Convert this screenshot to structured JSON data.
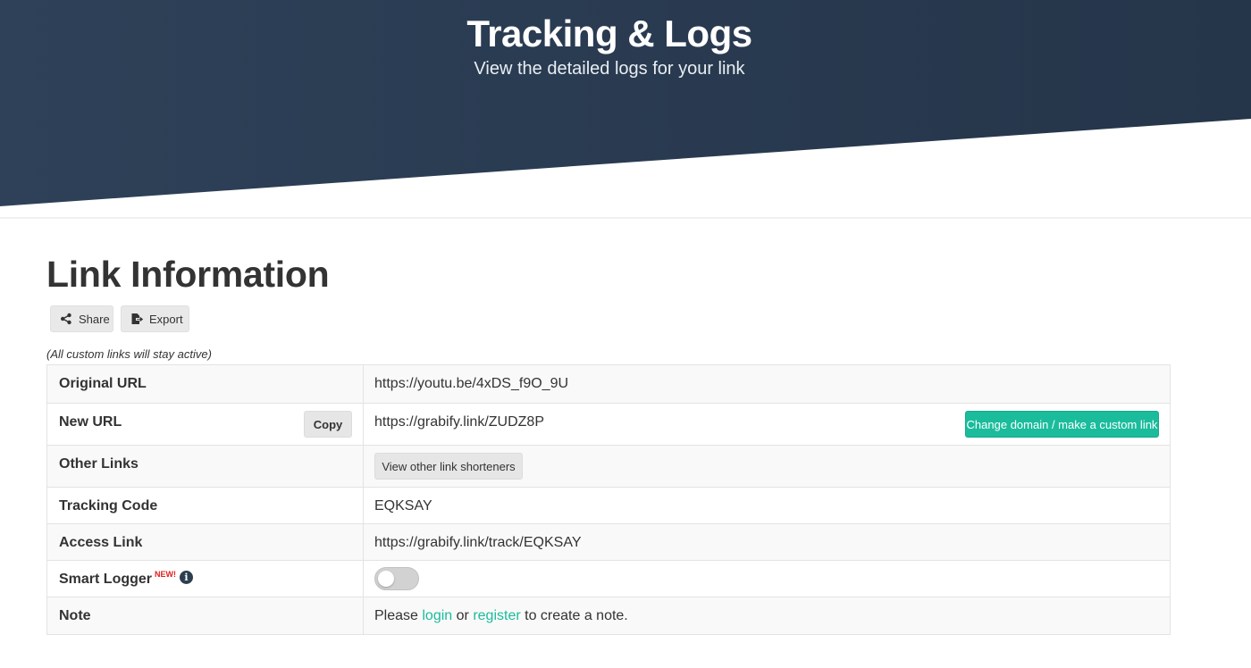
{
  "header": {
    "title": "Tracking & Logs",
    "subtitle": "View the detailed logs for your link",
    "color": "#2b3d52"
  },
  "section": {
    "title": "Link Information",
    "share_label": "Share",
    "export_label": "Export",
    "note": "(All custom links will stay active)"
  },
  "table": {
    "original_url": {
      "label": "Original URL",
      "value": "https://youtu.be/4xDS_f9O_9U"
    },
    "new_url": {
      "label": "New URL",
      "copy_label": "Copy",
      "value": "https://grabify.link/ZUDZ8P",
      "change_label": "Change domain / make a custom link"
    },
    "other_links": {
      "label": "Other Links",
      "button_label": "View other link shorteners"
    },
    "tracking_code": {
      "label": "Tracking Code",
      "value": "EQKSAY"
    },
    "access_link": {
      "label": "Access Link",
      "value": "https://grabify.link/track/EQKSAY"
    },
    "smart_logger": {
      "label": "Smart Logger",
      "badge": "NEW!",
      "info_icon": "i",
      "enabled": false
    },
    "note": {
      "label": "Note",
      "prefix": "Please ",
      "login": "login",
      "middle": " or ",
      "register": "register",
      "suffix": " to create a note."
    }
  },
  "colors": {
    "accent": "#1abc9c",
    "badge_red": "#e02020"
  }
}
